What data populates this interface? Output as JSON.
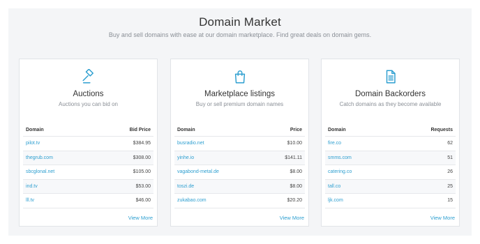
{
  "header": {
    "title": "Domain Market",
    "subtitle": "Buy and sell domains with ease at our domain marketplace. Find great deals on domain gems."
  },
  "accent_color": "#2e9fd0",
  "cards": [
    {
      "icon": "gavel-icon",
      "title": "Auctions",
      "subtitle": "Auctions you can bid on",
      "columns": [
        "Domain",
        "Bid Price"
      ],
      "rows": [
        {
          "domain": "pilot.tv",
          "value": "$384.95"
        },
        {
          "domain": "thegrub.com",
          "value": "$308.00"
        },
        {
          "domain": "sbcglonal.net",
          "value": "$105.00"
        },
        {
          "domain": "ind.tv",
          "value": "$53.00"
        },
        {
          "domain": "lll.tv",
          "value": "$46.00"
        }
      ],
      "view_more": "View More"
    },
    {
      "icon": "shopping-bag-icon",
      "title": "Marketplace listings",
      "subtitle": "Buy or sell premium domain names",
      "columns": [
        "Domain",
        "Price"
      ],
      "rows": [
        {
          "domain": "busradio.net",
          "value": "$10.00"
        },
        {
          "domain": "yinhe.io",
          "value": "$141.11"
        },
        {
          "domain": "vagabond-metal.de",
          "value": "$8.00"
        },
        {
          "domain": "toszi.de",
          "value": "$8.00"
        },
        {
          "domain": "zukabao.com",
          "value": "$20.20"
        }
      ],
      "view_more": "View More"
    },
    {
      "icon": "document-icon",
      "title": "Domain Backorders",
      "subtitle": "Catch domains as they become available",
      "columns": [
        "Domain",
        "Requests"
      ],
      "rows": [
        {
          "domain": "fire.co",
          "value": "62"
        },
        {
          "domain": "smms.com",
          "value": "51"
        },
        {
          "domain": "catering.co",
          "value": "26"
        },
        {
          "domain": "tall.co",
          "value": "25"
        },
        {
          "domain": "ljk.com",
          "value": "15"
        }
      ],
      "view_more": "View More"
    }
  ]
}
